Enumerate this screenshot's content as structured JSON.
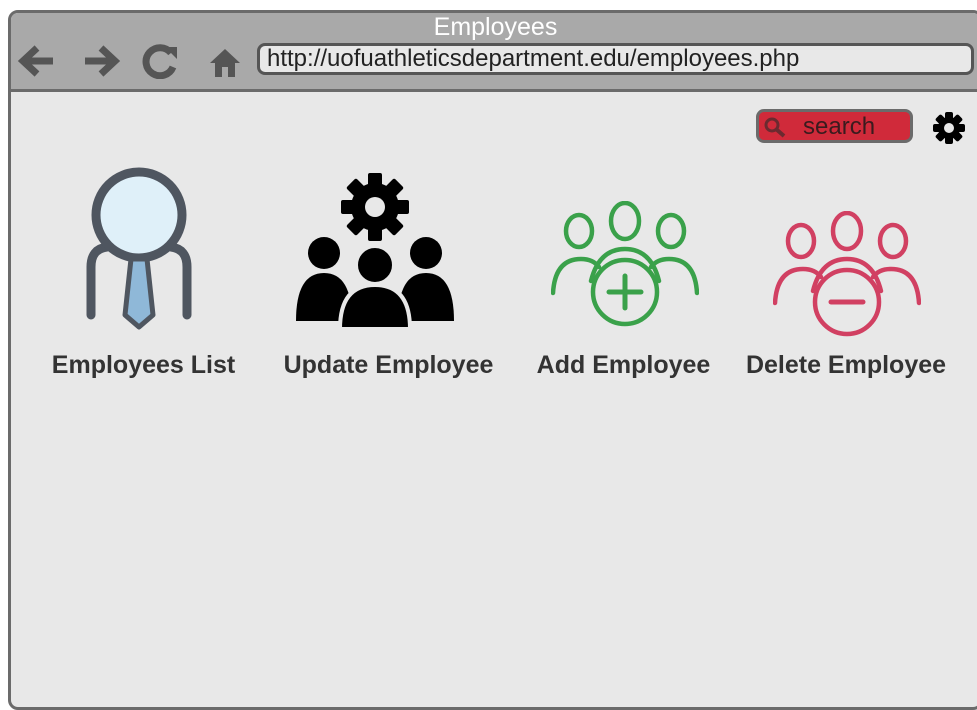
{
  "window": {
    "title": "Employees"
  },
  "toolbar": {
    "url": "http://uofuathleticsdepartment.edu/employees.php",
    "back_icon": "arrow-left-icon",
    "forward_icon": "arrow-right-icon",
    "reload_icon": "reload-icon",
    "home_icon": "home-icon"
  },
  "search": {
    "label": "search",
    "icon": "search-icon",
    "color": "#d02a3a"
  },
  "settings": {
    "icon": "gear-icon"
  },
  "tiles": [
    {
      "label": "Employees List",
      "icon": "employee-tie-icon"
    },
    {
      "label": "Update Employee",
      "icon": "group-gear-icon"
    },
    {
      "label": "Add Employee",
      "icon": "group-add-icon",
      "color": "#3aa14a"
    },
    {
      "label": "Delete Employee",
      "icon": "group-remove-icon",
      "color": "#d14062"
    }
  ]
}
